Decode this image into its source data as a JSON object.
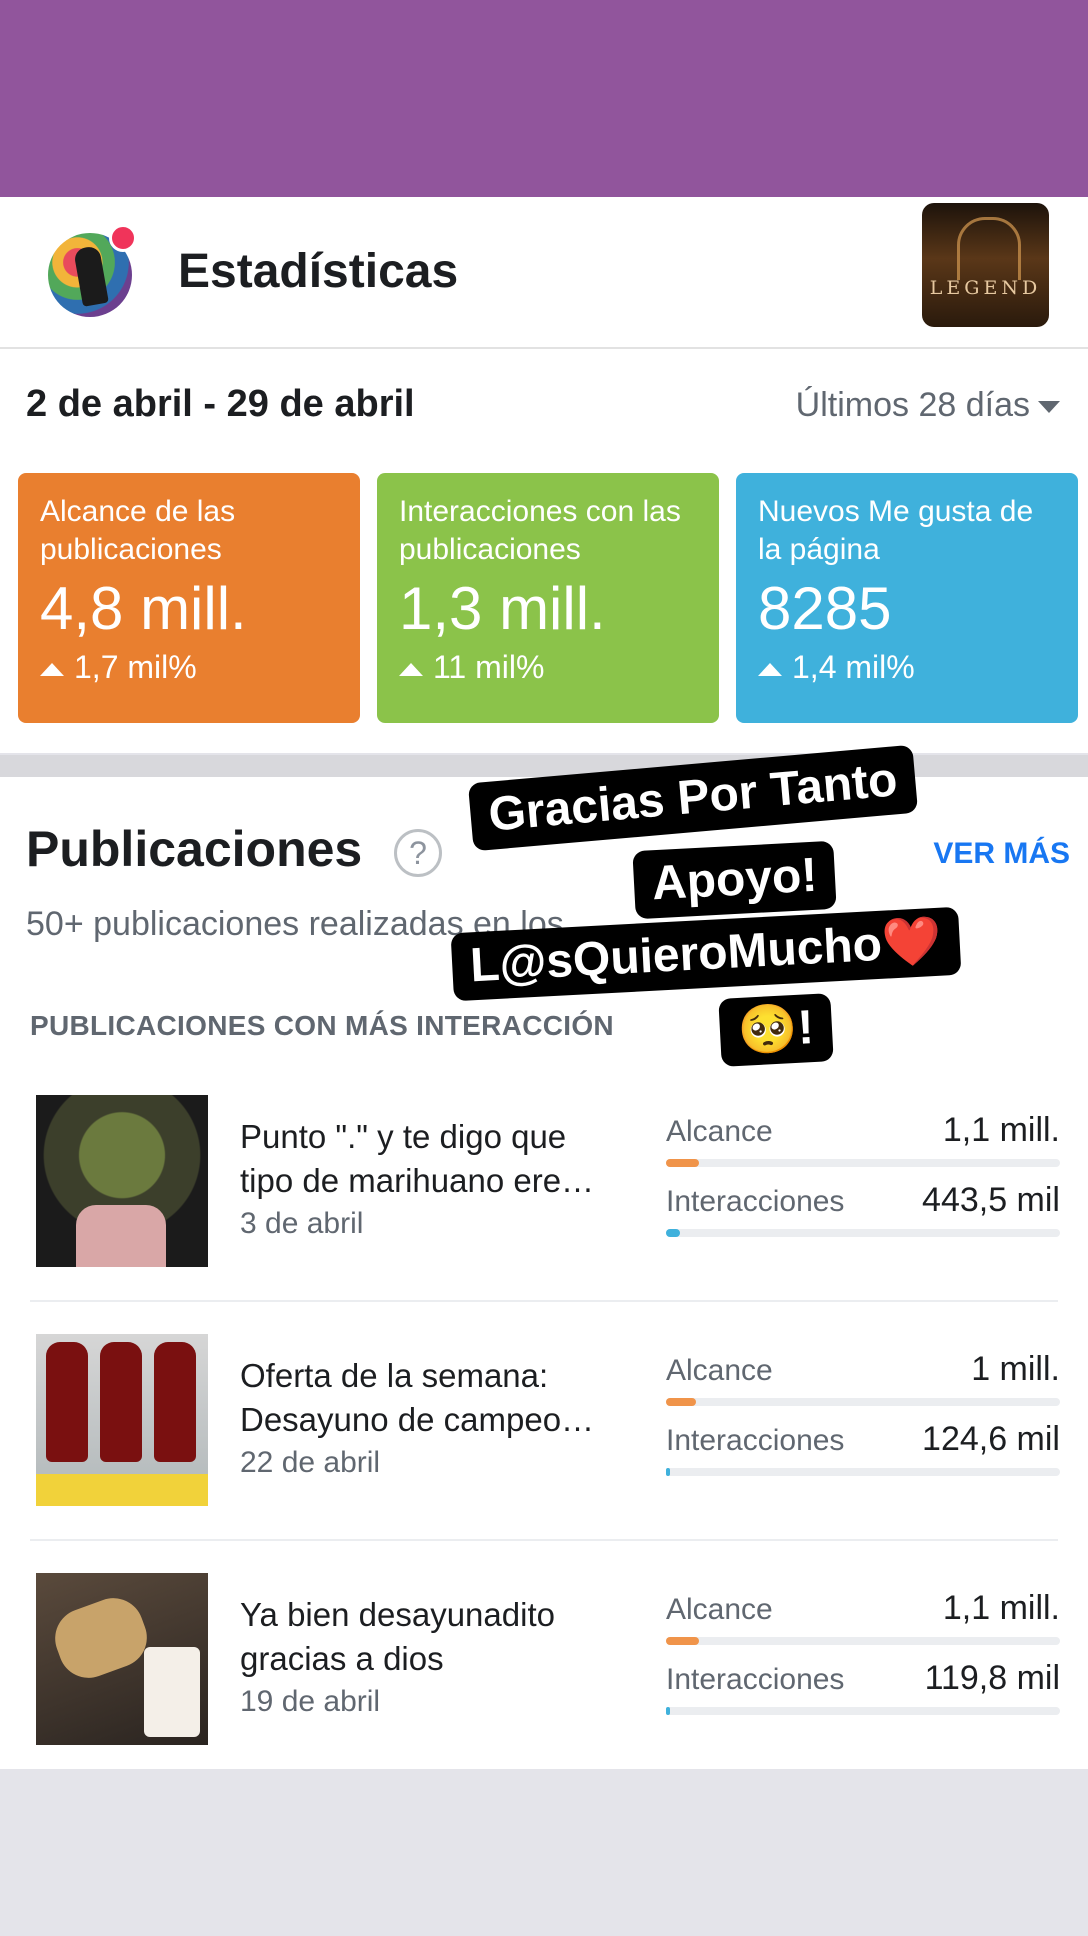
{
  "header": {
    "title": "Estadísticas",
    "thumb_text": "LEGEND"
  },
  "stats": {
    "date_range": "2 de abril - 29 de abril",
    "period": "Últimos 28 días",
    "cards": [
      {
        "label": "Alcance de las publicaciones",
        "value": "4,8 mill.",
        "change": "1,7 mil%",
        "color": "#e97f2f"
      },
      {
        "label": "Interacciones con las publicaciones",
        "value": "1,3 mill.",
        "change": "11 mil%",
        "color": "#8bc34a"
      },
      {
        "label": "Nuevos Me gusta de la página",
        "value": "8285",
        "change": "1,4 mil%",
        "color": "#3fb1dc"
      }
    ]
  },
  "publicaciones": {
    "title": "Publicaciones",
    "help_icon": "?",
    "ver_mas": "VER MÁS",
    "subtitle": "50+ publicaciones realizadas en los",
    "section_header": "PUBLICACIONES CON MÁS INTERACCIÓN",
    "posts": [
      {
        "title_line1": "Punto \".\" y te digo que",
        "title_line2": "tipo de marihuano ere…",
        "date": "3 de abril",
        "reach_label": "Alcance",
        "reach_value": "1,1 mill.",
        "reach_fraction": 0.085,
        "inter_label": "Interacciones",
        "inter_value": "443,5 mil",
        "inter_fraction": 0.035
      },
      {
        "title_line1": "Oferta de la semana:",
        "title_line2": "Desayuno de campeo…",
        "date": "22 de abril",
        "reach_label": "Alcance",
        "reach_value": "1 mill.",
        "reach_fraction": 0.075,
        "inter_label": "Interacciones",
        "inter_value": "124,6 mil",
        "inter_fraction": 0.01
      },
      {
        "title_line1": "Ya bien desayunadito",
        "title_line2": "gracias a dios",
        "date": "19 de abril",
        "reach_label": "Alcance",
        "reach_value": "1,1 mill.",
        "reach_fraction": 0.085,
        "inter_label": "Interacciones",
        "inter_value": "119,8 mil",
        "inter_fraction": 0.01
      }
    ]
  },
  "overlay": {
    "line1": "Gracias Por Tanto",
    "line2": "Apoyo!",
    "line3": "L@sQuieroMucho❤️",
    "line4": "🥺!"
  },
  "colors": {
    "top_bar": "#91559c",
    "reach_bar": "#f0944a",
    "inter_bar": "#3fb1dc",
    "link": "#1877f2"
  }
}
